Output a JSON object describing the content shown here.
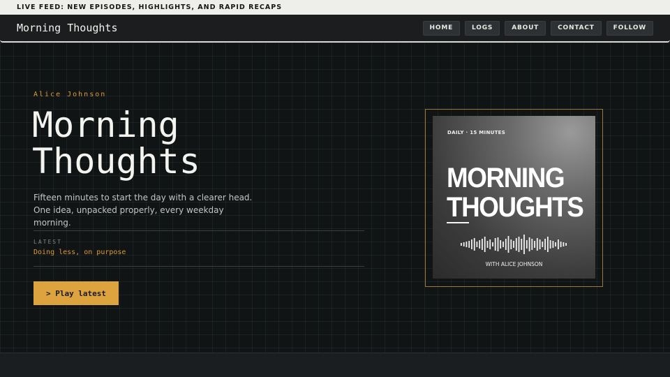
{
  "ticker": {
    "text": "LIVE FEED:  NEW EPISODES, HIGHLIGHTS, AND RAPID RECAPS"
  },
  "header": {
    "brand": "Morning Thoughts",
    "nav": [
      {
        "label": "HOME"
      },
      {
        "label": "LOGS"
      },
      {
        "label": "ABOUT"
      },
      {
        "label": "CONTACT"
      },
      {
        "label": "FOLLOW"
      }
    ]
  },
  "hero": {
    "host": "Alice Johnson",
    "title_line1": "Morning",
    "title_line2": "Thoughts",
    "description": "Fifteen minutes to start the day with a clearer head. One idea, unpacked properly, every weekday morning.",
    "latest_label": "LATEST",
    "latest_title": "Doing less, on purpose",
    "play_label": "> Play latest"
  },
  "cover": {
    "kicker": "DAILY · 15 MINUTES",
    "title_line1": "MORNING",
    "title_line2": "THOUGHTS",
    "byline": "WITH ALICE JOHNSON"
  },
  "colors": {
    "accent": "#dca33e",
    "background": "#111415",
    "ticker_bg": "#eeeeea"
  }
}
